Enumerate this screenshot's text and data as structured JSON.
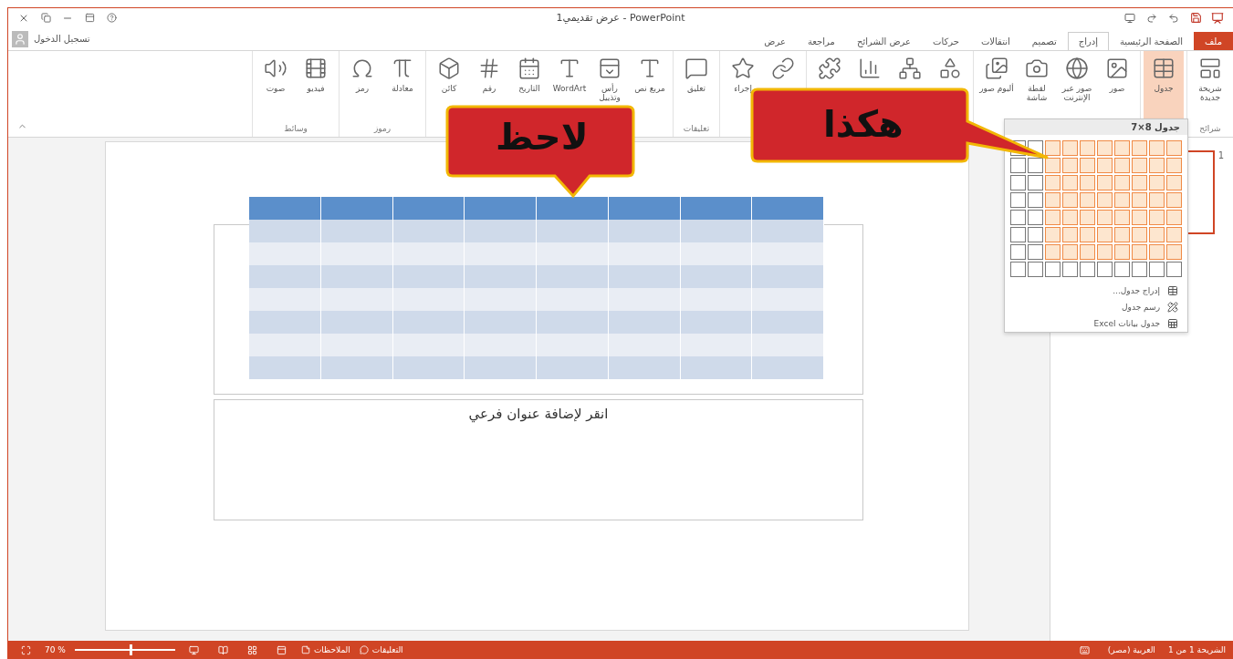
{
  "window": {
    "title": "عرض تقديمي1 - PowerPoint",
    "account": "تسجيل الدخول"
  },
  "tabs": [
    {
      "label": "ملف",
      "kind": "file",
      "selected": false
    },
    {
      "label": "الصفحة الرئيسية",
      "kind": "tab",
      "selected": false
    },
    {
      "label": "إدراج",
      "kind": "tab",
      "selected": true
    },
    {
      "label": "تصميم",
      "kind": "tab",
      "selected": false
    },
    {
      "label": "انتقالات",
      "kind": "tab",
      "selected": false
    },
    {
      "label": "حركات",
      "kind": "tab",
      "selected": false
    },
    {
      "label": "عرض الشرائح",
      "kind": "tab",
      "selected": false
    },
    {
      "label": "مراجعة",
      "kind": "tab",
      "selected": false
    },
    {
      "label": "عرض",
      "kind": "tab",
      "selected": false
    }
  ],
  "ribbon": [
    {
      "label": "شرائح",
      "buttons": [
        {
          "label": "شريحة جديدة",
          "selected": false
        }
      ]
    },
    {
      "buttons": [
        {
          "label": "جدول",
          "selected": true
        }
      ]
    },
    {
      "buttons": [
        {
          "label": "صور",
          "selected": false
        },
        {
          "label": "صور عبر الإنترنت",
          "selected": false
        },
        {
          "label": "لقطة شاشة",
          "selected": false
        },
        {
          "label": "ألبوم صور",
          "selected": false
        }
      ]
    },
    {
      "buttons": [
        {
          "selected": false
        },
        {
          "selected": false
        },
        {
          "selected": false
        },
        {
          "selected": false
        }
      ]
    },
    {
      "buttons": [
        {
          "selected": false
        },
        {
          "label": "إجراء",
          "selected": false
        }
      ]
    },
    {
      "label": "تعليقات",
      "buttons": [
        {
          "label": "تعليق",
          "selected": false
        }
      ]
    },
    {
      "buttons": [
        {
          "label": "مربع نص",
          "selected": false
        },
        {
          "label": "رأس وتذييل",
          "selected": false
        },
        {
          "label": "WordArt",
          "selected": false
        },
        {
          "label": "التاريخ",
          "selected": false
        },
        {
          "label": "رقم",
          "selected": false
        },
        {
          "label": "كائن",
          "selected": false
        }
      ]
    },
    {
      "label": "رموز",
      "buttons": [
        {
          "label": "معادلة",
          "selected": false
        },
        {
          "label": "رمز",
          "selected": false
        }
      ]
    },
    {
      "label": "وسائط",
      "buttons": [
        {
          "label": "فيديو",
          "selected": false
        },
        {
          "label": "صوت",
          "selected": false
        }
      ]
    }
  ],
  "table_picker": {
    "header": "جدول 8×7",
    "rows": [
      [
        {
          "selected": true
        },
        {
          "selected": true
        },
        {
          "selected": true
        },
        {
          "selected": true
        },
        {
          "selected": true
        },
        {
          "selected": true
        },
        {
          "selected": true
        },
        {
          "selected": true
        },
        {
          "selected": false
        },
        {
          "selected": false
        }
      ],
      [
        {
          "selected": true
        },
        {
          "selected": true
        },
        {
          "selected": true
        },
        {
          "selected": true
        },
        {
          "selected": true
        },
        {
          "selected": true
        },
        {
          "selected": true
        },
        {
          "selected": true
        },
        {
          "selected": false
        },
        {
          "selected": false
        }
      ],
      [
        {
          "selected": true
        },
        {
          "selected": true
        },
        {
          "selected": true
        },
        {
          "selected": true
        },
        {
          "selected": true
        },
        {
          "selected": true
        },
        {
          "selected": true
        },
        {
          "selected": true
        },
        {
          "selected": false
        },
        {
          "selected": false
        }
      ],
      [
        {
          "selected": true
        },
        {
          "selected": true
        },
        {
          "selected": true
        },
        {
          "selected": true
        },
        {
          "selected": true
        },
        {
          "selected": true
        },
        {
          "selected": true
        },
        {
          "selected": true
        },
        {
          "selected": false
        },
        {
          "selected": false
        }
      ],
      [
        {
          "selected": true
        },
        {
          "selected": true
        },
        {
          "selected": true
        },
        {
          "selected": true
        },
        {
          "selected": true
        },
        {
          "selected": true
        },
        {
          "selected": true
        },
        {
          "selected": true
        },
        {
          "selected": false
        },
        {
          "selected": false
        }
      ],
      [
        {
          "selected": true
        },
        {
          "selected": true
        },
        {
          "selected": true
        },
        {
          "selected": true
        },
        {
          "selected": true
        },
        {
          "selected": true
        },
        {
          "selected": true
        },
        {
          "selected": true
        },
        {
          "selected": false
        },
        {
          "selected": false
        }
      ],
      [
        {
          "selected": true
        },
        {
          "selected": true
        },
        {
          "selected": true
        },
        {
          "selected": true
        },
        {
          "selected": true
        },
        {
          "selected": true
        },
        {
          "selected": true
        },
        {
          "selected": true
        },
        {
          "selected": false
        },
        {
          "selected": false
        }
      ],
      [
        {
          "selected": false
        },
        {
          "selected": false
        },
        {
          "selected": false
        },
        {
          "selected": false
        },
        {
          "selected": false
        },
        {
          "selected": false
        },
        {
          "selected": false
        },
        {
          "selected": false
        },
        {
          "selected": false
        },
        {
          "selected": false
        }
      ]
    ],
    "menu": [
      "إدراج جدول...",
      "رسم جدول",
      "جدول بيانات Excel"
    ]
  },
  "slide": {
    "subtitle_placeholder": "انقر لإضافة عنوان فرعي",
    "thumbnail_number": "1"
  },
  "callouts": [
    {
      "text": "لاحظ",
      "kind": "down"
    },
    {
      "text": "هكذا",
      "kind": "right"
    }
  ],
  "status_bar": {
    "slide": "الشريحة 1 من 1",
    "language": "العربية (مصر)",
    "notes": "الملاحظات",
    "comments": "التعليقات",
    "zoom": "70 %",
    "zoom_slider": {
      "level": 0.55
    }
  }
}
